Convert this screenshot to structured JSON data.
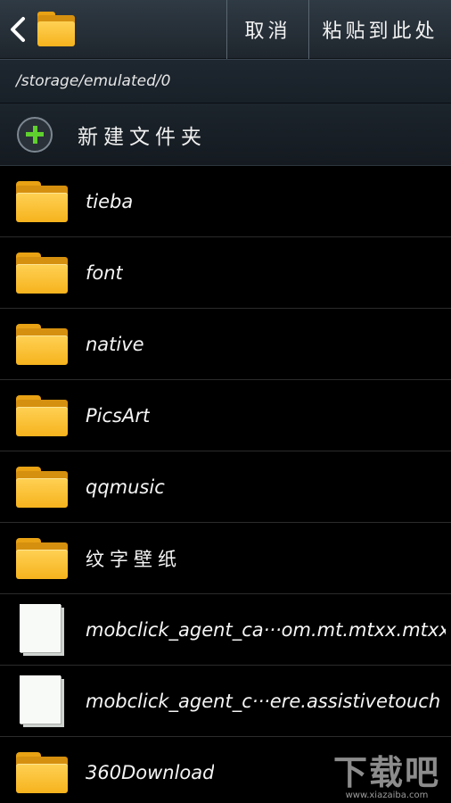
{
  "header": {
    "cancel_label": "取消",
    "paste_label": "粘贴到此处"
  },
  "path": "/storage/emulated/0",
  "new_folder_label": "新建文件夹",
  "items": [
    {
      "type": "folder",
      "name": "tieba"
    },
    {
      "type": "folder",
      "name": "font"
    },
    {
      "type": "folder",
      "name": "native"
    },
    {
      "type": "folder",
      "name": "PicsArt"
    },
    {
      "type": "folder",
      "name": "qqmusic"
    },
    {
      "type": "folder",
      "name": "纹字壁纸"
    },
    {
      "type": "file",
      "name": "mobclick_agent_ca···om.mt.mtxx.mtxx"
    },
    {
      "type": "file",
      "name": "mobclick_agent_c···ere.assistivetouch"
    },
    {
      "type": "folder",
      "name": "360Download"
    }
  ],
  "watermark": {
    "logo": "下载吧",
    "url": "www.xiazaiba.com"
  },
  "colors": {
    "folder_front": "#f6b31d",
    "folder_back": "#d6900f",
    "plus_green": "#5fd02e",
    "topbar": "#2f3a44"
  }
}
